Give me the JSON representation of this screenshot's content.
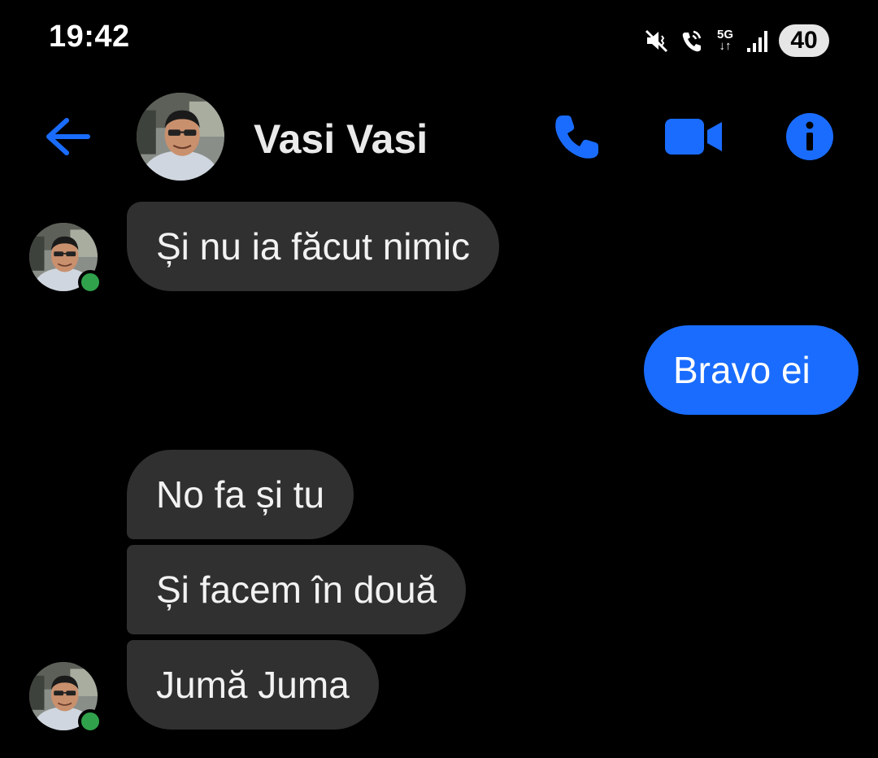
{
  "status_bar": {
    "time": "19:42",
    "network": "5G",
    "battery": "40",
    "icons": [
      "mute-icon",
      "wifi-call-icon",
      "network-5g-icon",
      "signal-icon",
      "battery-icon"
    ]
  },
  "header": {
    "contact_name": "Vasi Vasi",
    "back_icon": "arrow-left-icon",
    "actions": [
      "phone-icon",
      "video-camera-icon",
      "info-icon"
    ]
  },
  "messages": [
    {
      "sender": "contact",
      "text": "Și nu ia făcut nimic"
    },
    {
      "sender": "me",
      "text": "Bravo ei"
    },
    {
      "sender": "contact",
      "text": "No fa și tu"
    },
    {
      "sender": "contact",
      "text": "Și facem în două"
    },
    {
      "sender": "contact",
      "text": "Jumă Juma"
    }
  ],
  "colors": {
    "background": "#000000",
    "accent": "#1a6cff",
    "incoming_bubble": "#303030",
    "online": "#31a24c"
  }
}
